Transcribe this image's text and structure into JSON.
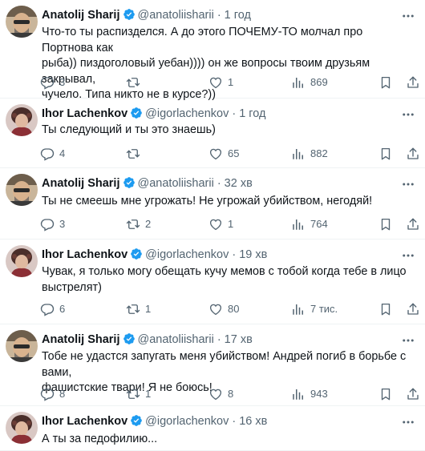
{
  "tweets": [
    {
      "author": "Anatolij Sharij",
      "handle": "@anatoliishariі",
      "time": "1 год",
      "lines": [
        "Что-то ты распизделся. А до этого ПОЧЕМУ-ТО молчал про Портнова как",
        "рыба)) пиздоголовый уебан)))) он же вопросы твоим друзьям закрывал,",
        "чучело. Типа никто не в курсе?))"
      ],
      "replies": "3",
      "retweets": "",
      "likes": "1",
      "views": "869"
    },
    {
      "author": "Ihor Lachenkov",
      "handle": "@igorlachenkov",
      "time": "1 год",
      "lines": [
        "Ты следующий и ты это знаешь)"
      ],
      "replies": "4",
      "retweets": "",
      "likes": "65",
      "views": "882"
    },
    {
      "author": "Anatolij Sharij",
      "handle": "@anatoliishariі",
      "time": "32 хв",
      "lines": [
        "Ты не смеешь мне угрожать! Не угрожай убийством, негодяй!"
      ],
      "replies": "3",
      "retweets": "2",
      "likes": "1",
      "views": "764"
    },
    {
      "author": "Ihor Lachenkov",
      "handle": "@igorlachenkov",
      "time": "19 хв",
      "lines": [
        "Чувак, я только могу обещать кучу мемов с тобой когда тебе в лицо",
        "выстрелят)"
      ],
      "replies": "6",
      "retweets": "1",
      "likes": "80",
      "views": "7 тис."
    },
    {
      "author": "Anatolij Sharij",
      "handle": "@anatoliishariі",
      "time": "17 хв",
      "lines": [
        "Тобе не удастся запугать меня убийством! Андрей погиб в борьбе с вами,",
        "фашистские твари! Я не боюсь!"
      ],
      "replies": "8",
      "retweets": "1",
      "likes": "8",
      "views": "943"
    },
    {
      "author": "Ihor Lachenkov",
      "handle": "@igorlachenkov",
      "time": "16 хв",
      "lines": [
        "А ты за педофилию..."
      ],
      "replies": "",
      "retweets": "",
      "likes": "",
      "views": ""
    }
  ],
  "separator": "·",
  "colors": {
    "verified": "#1d9bf0",
    "secondary": "#536471",
    "text": "#0f1419",
    "border": "#eff3f4"
  },
  "icons": [
    "verified-badge-icon",
    "more-icon",
    "reply-icon",
    "retweet-icon",
    "like-icon",
    "views-icon",
    "bookmark-icon",
    "share-icon"
  ]
}
